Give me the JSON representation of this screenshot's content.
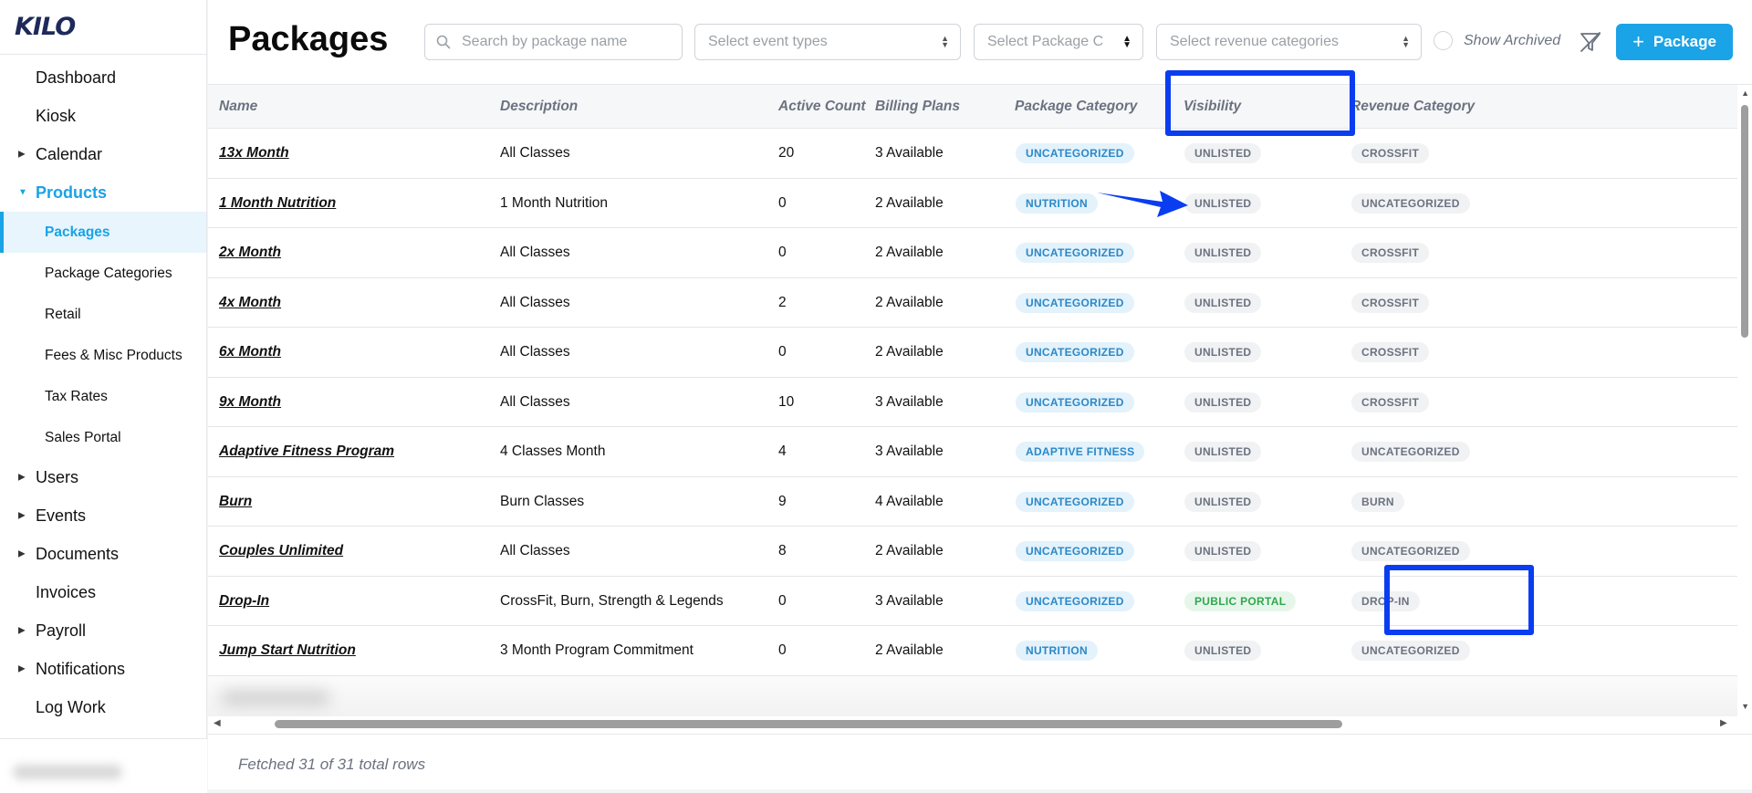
{
  "app": {
    "logo": "KILO"
  },
  "sidebar": {
    "items": [
      {
        "label": "Dashboard",
        "caret": false
      },
      {
        "label": "Kiosk",
        "caret": false
      },
      {
        "label": "Calendar",
        "caret": true
      }
    ],
    "products": {
      "label": "Products",
      "children": [
        "Packages",
        "Package Categories",
        "Retail",
        "Fees & Misc Products",
        "Tax Rates",
        "Sales Portal"
      ]
    },
    "items_after": [
      {
        "label": "Users",
        "caret": true
      },
      {
        "label": "Events",
        "caret": true
      },
      {
        "label": "Documents",
        "caret": true
      },
      {
        "label": "Invoices",
        "caret": false
      },
      {
        "label": "Payroll",
        "caret": true
      },
      {
        "label": "Notifications",
        "caret": true
      },
      {
        "label": "Log Work",
        "caret": false
      }
    ]
  },
  "header": {
    "title": "Packages",
    "search_placeholder": "Search by package name",
    "event_types_placeholder": "Select event types",
    "package_category_placeholder": "Select Package C",
    "revenue_categories_placeholder": "Select revenue categories",
    "show_archived_label": "Show Archived",
    "add_button_label": "Package"
  },
  "table": {
    "columns": [
      "Name",
      "Description",
      "Active Count",
      "Billing Plans",
      "Package Category",
      "Visibility",
      "Revenue Category"
    ],
    "rows": [
      {
        "name": "13x Month",
        "description": "All Classes",
        "active_count": "20",
        "billing_plans": "3 Available",
        "package_category": "UNCATEGORIZED",
        "visibility": "UNLISTED",
        "revenue_category": "CROSSFIT"
      },
      {
        "name": "1 Month Nutrition",
        "description": "1 Month Nutrition",
        "active_count": "0",
        "billing_plans": "2 Available",
        "package_category": "NUTRITION",
        "visibility": "UNLISTED",
        "revenue_category": "UNCATEGORIZED"
      },
      {
        "name": "2x Month",
        "description": "All Classes",
        "active_count": "0",
        "billing_plans": "2 Available",
        "package_category": "UNCATEGORIZED",
        "visibility": "UNLISTED",
        "revenue_category": "CROSSFIT"
      },
      {
        "name": "4x Month",
        "description": "All Classes",
        "active_count": "2",
        "billing_plans": "2 Available",
        "package_category": "UNCATEGORIZED",
        "visibility": "UNLISTED",
        "revenue_category": "CROSSFIT"
      },
      {
        "name": "6x Month",
        "description": "All Classes",
        "active_count": "0",
        "billing_plans": "2 Available",
        "package_category": "UNCATEGORIZED",
        "visibility": "UNLISTED",
        "revenue_category": "CROSSFIT"
      },
      {
        "name": "9x Month",
        "description": "All Classes",
        "active_count": "10",
        "billing_plans": "3 Available",
        "package_category": "UNCATEGORIZED",
        "visibility": "UNLISTED",
        "revenue_category": "CROSSFIT"
      },
      {
        "name": "Adaptive Fitness Program",
        "description": "4 Classes Month",
        "active_count": "4",
        "billing_plans": "3 Available",
        "package_category": "ADAPTIVE FITNESS",
        "visibility": "UNLISTED",
        "revenue_category": "UNCATEGORIZED"
      },
      {
        "name": "Burn",
        "description": "Burn Classes",
        "active_count": "9",
        "billing_plans": "4 Available",
        "package_category": "UNCATEGORIZED",
        "visibility": "UNLISTED",
        "revenue_category": "BURN"
      },
      {
        "name": "Couples Unlimited",
        "description": "All Classes",
        "active_count": "8",
        "billing_plans": "2 Available",
        "package_category": "UNCATEGORIZED",
        "visibility": "UNLISTED",
        "revenue_category": "UNCATEGORIZED"
      },
      {
        "name": "Drop-In",
        "description": "CrossFit, Burn, Strength & Legends",
        "active_count": "0",
        "billing_plans": "3 Available",
        "package_category": "UNCATEGORIZED",
        "visibility": "PUBLIC PORTAL",
        "revenue_category": "DROP-IN"
      },
      {
        "name": "Jump Start Nutrition",
        "description": "3 Month Program Commitment",
        "active_count": "0",
        "billing_plans": "2 Available",
        "package_category": "NUTRITION",
        "visibility": "UNLISTED",
        "revenue_category": "UNCATEGORIZED"
      }
    ],
    "footer_text": "Fetched 31 of 31 total rows"
  },
  "colors": {
    "accent": "#1aa3e6",
    "annotation": "#0a3df0",
    "badge_blue_text": "#2b88c8",
    "badge_green_text": "#2fa84f"
  }
}
